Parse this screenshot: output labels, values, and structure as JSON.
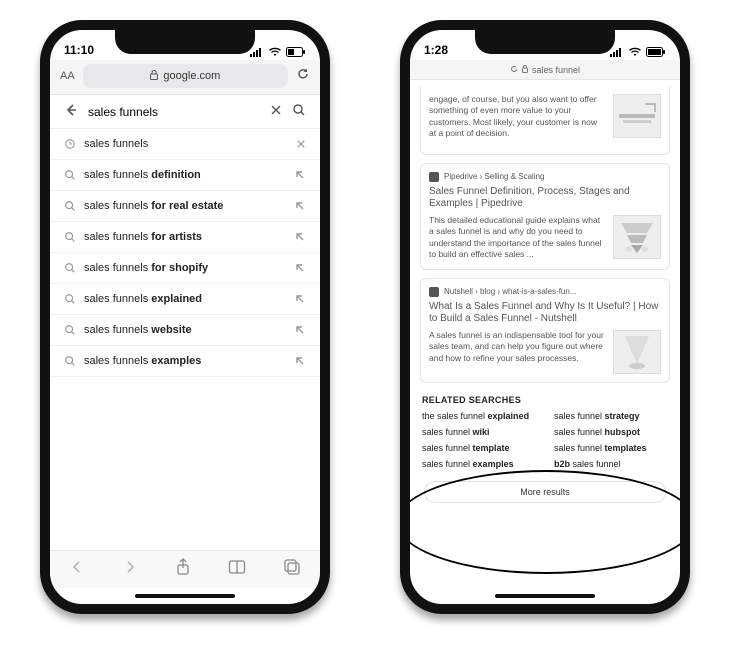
{
  "phone1": {
    "status": {
      "time": "11:10"
    },
    "address": {
      "domain": "google.com"
    },
    "search": {
      "query": "sales funnels"
    },
    "suggestions": [
      {
        "icon": "clock",
        "prefix": "sales funnels",
        "bold": "",
        "tail": "x"
      },
      {
        "icon": "search",
        "prefix": "sales funnels ",
        "bold": "definition",
        "tail": "arrow"
      },
      {
        "icon": "search",
        "prefix": "sales funnels ",
        "bold": "for real estate",
        "tail": "arrow"
      },
      {
        "icon": "search",
        "prefix": "sales funnels ",
        "bold": "for artists",
        "tail": "arrow"
      },
      {
        "icon": "search",
        "prefix": "sales funnels ",
        "bold": "for shopify",
        "tail": "arrow"
      },
      {
        "icon": "search",
        "prefix": "sales funnels ",
        "bold": "explained",
        "tail": "arrow"
      },
      {
        "icon": "search",
        "prefix": "sales funnels ",
        "bold": "website",
        "tail": "arrow"
      },
      {
        "icon": "search",
        "prefix": "sales funnels ",
        "bold": "examples",
        "tail": "arrow"
      }
    ]
  },
  "phone2": {
    "status": {
      "time": "1:28"
    },
    "address": {
      "label": "sales funnel"
    },
    "partial_snippet": "engage, of course, but you also want to offer something of even more value to your customers. Most likely, your customer is now at a point of decision.",
    "cards": [
      {
        "source": "Pipedrive › Selling & Scaling",
        "title": "Sales Funnel Definition, Process, Stages and Examples | Pipedrive",
        "snippet": "This detailed educational guide explains what a sales funnel is and why do you need to understand the importance of the sales funnel to build an effective sales ..."
      },
      {
        "source": "Nutshell › blog › what-is-a-sales-fun...",
        "title": "What Is a Sales Funnel and Why Is It Useful? | How to Build a Sales Funnel - Nutshell",
        "snippet": "A sales funnel is an indispensable tool for your sales team, and can help you figure out where and how to refine your sales processes."
      }
    ],
    "related": {
      "heading": "RELATED SEARCHES",
      "items": [
        {
          "plain": "the sales funnel ",
          "bold": "explained"
        },
        {
          "plain": "sales funnel ",
          "bold": "strategy"
        },
        {
          "plain": "sales funnel ",
          "bold": "wiki"
        },
        {
          "plain": "sales funnel ",
          "bold": "hubspot"
        },
        {
          "plain": "sales funnel ",
          "bold": "template"
        },
        {
          "plain": "sales funnel ",
          "bold": "templates"
        },
        {
          "plain": "sales funnel ",
          "bold": "examples"
        },
        {
          "plain": "",
          "bold": "b2b",
          "plain2": " sales funnel"
        }
      ]
    },
    "more_results": "More results"
  }
}
